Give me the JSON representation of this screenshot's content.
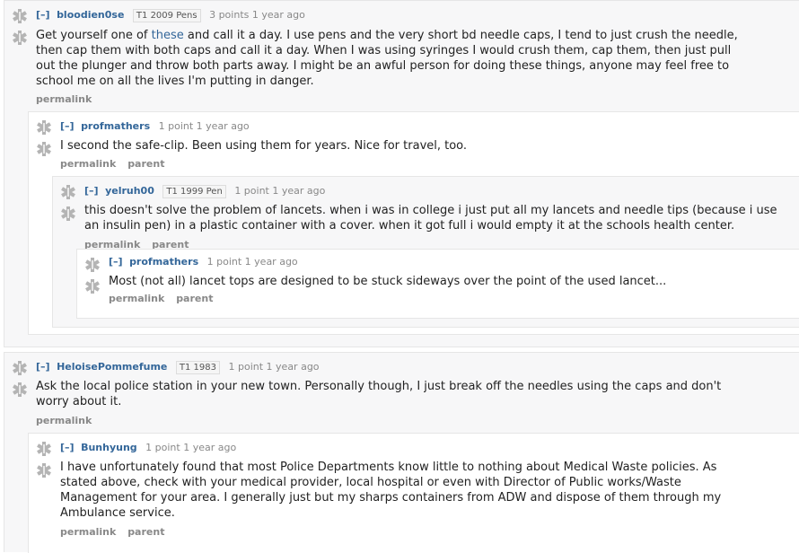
{
  "common": {
    "toggle": "[–]",
    "permalink": "permalink",
    "parent": "parent",
    "star_icon": "medical-star-icon"
  },
  "comments": [
    {
      "author": "bloodien0se",
      "flair": "T1 2009 Pens",
      "meta": "3 points 1 year ago",
      "body_before": "Get yourself one of ",
      "body_link": "these",
      "body_after": " and call it a day. I use pens and the very short bd needle caps, I tend to just crush the needle, then cap them with both caps and call it a day. When I was using syringes I would crush them, cap them, then just pull out the plunger and throw both parts away. I might be an awful person for doing these things, anyone may feel free to school me on all the lives I'm putting in danger."
    },
    {
      "author": "profmathers",
      "meta": "1 point 1 year ago",
      "body": "I second the safe-clip. Been using them for years. Nice for travel, too."
    },
    {
      "author": "yelruh00",
      "flair": "T1 1999 Pen",
      "meta": "1 point 1 year ago",
      "body": "this doesn't solve the problem of lancets. when i was in college i just put all my lancets and needle tips (because i use an insulin pen) in a plastic container with a cover. when it got full i would empty it at the schools health center."
    },
    {
      "author": "profmathers",
      "meta": "1 point 1 year ago",
      "body": "Most (not all) lancet tops are designed to be stuck sideways over the point of the used lancet..."
    },
    {
      "author": "HeloisePommefume",
      "flair": "T1 1983",
      "meta": "1 point 1 year ago",
      "body": "Ask the local police station in your new town. Personally though, I just break off the needles using the caps and don't worry about it."
    },
    {
      "author": "Bunhyung",
      "meta": "1 point 1 year ago",
      "body": "I have unfortunately found that most Police Departments know little to nothing about Medical Waste policies. As stated above, check with your medical provider, local hospital or even with Director of Public works/Waste Management for your area. I generally just but my sharps containers from ADW and dispose of them through my Ambulance service."
    }
  ]
}
